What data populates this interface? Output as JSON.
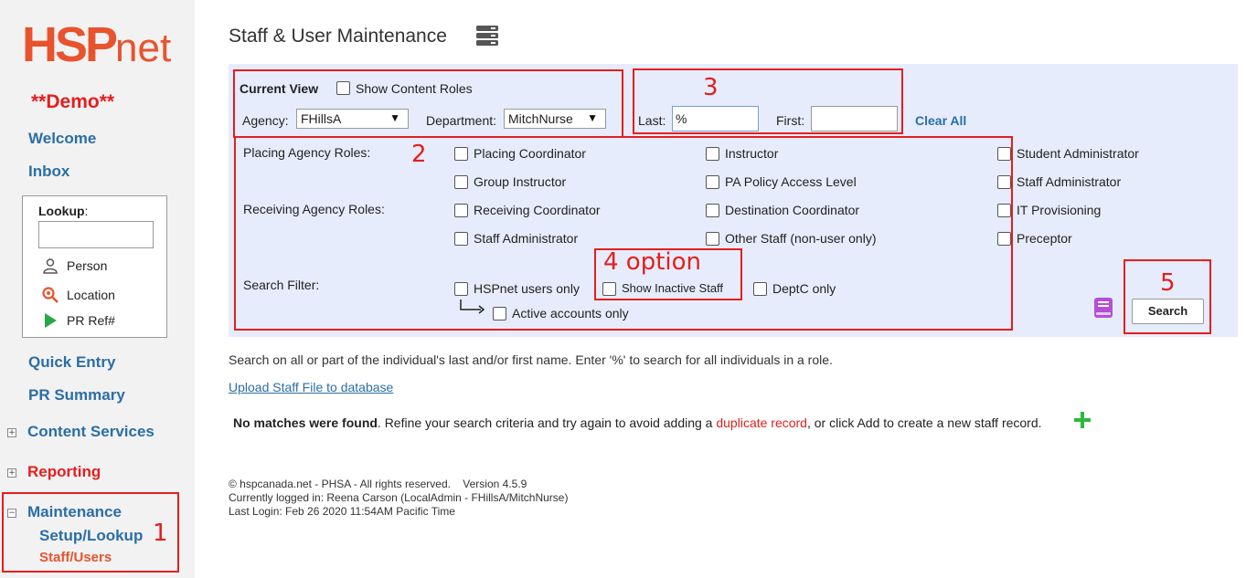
{
  "sidebar": {
    "logo": {
      "hsp": "HSP",
      "net": "net"
    },
    "demo": "**Demo**",
    "welcome": "Welcome",
    "inbox": "Inbox",
    "lookup": {
      "label": "Lookup",
      "colon": ":",
      "input_value": "",
      "person": "Person",
      "location": "Location",
      "pr_ref": "PR Ref#"
    },
    "quick_entry": "Quick Entry",
    "pr_summary": "PR Summary",
    "content_services": "Content Services",
    "reporting": "Reporting",
    "maintenance": "Maintenance",
    "setup_lookup": "Setup/Lookup",
    "staff_users": "Staff/Users",
    "expand_plus": "+",
    "expand_minus": "−"
  },
  "main": {
    "title": "Staff & User Maintenance",
    "current_view": "Current View",
    "show_content_roles": "Show Content Roles",
    "agency_label": "Agency:",
    "agency_value": "FHillsA",
    "department_label": "Department:",
    "department_value": "MitchNurse",
    "last_label": "Last:",
    "last_value": "%",
    "first_label": "First:",
    "first_value": "",
    "clear_all": "Clear All",
    "placing_roles_label": "Placing Agency Roles:",
    "receiving_roles_label": "Receiving Agency Roles:",
    "search_filter_label": "Search Filter:",
    "roles": {
      "placing_coordinator": "Placing Coordinator",
      "group_instructor": "Group Instructor",
      "receiving_coordinator": "Receiving Coordinator",
      "staff_administrator": "Staff Administrator",
      "instructor": "Instructor",
      "pa_policy_access_level": "PA Policy Access Level",
      "destination_coordinator": "Destination Coordinator",
      "other_staff": "Other Staff (non-user only)",
      "student_administrator": "Student Administrator",
      "staff_administrator_2": "Staff Administrator",
      "it_provisioning": "IT Provisioning",
      "preceptor": "Preceptor"
    },
    "filters": {
      "hspnet_users_only": "HSPnet users only",
      "show_inactive_staff": "Show Inactive Staff",
      "deptc_only": "DeptC only",
      "active_accounts_only": "Active accounts only"
    },
    "search_button": "Search",
    "info_text": "Search on all or part of the individual's last and/or first name. Enter '%' to search for all individuals in a role.",
    "upload_link": "Upload Staff File to database",
    "no_matches_bold": "No matches were found",
    "no_matches_text": ". Refine your search criteria and try again to avoid adding a ",
    "duplicate_record": "duplicate record",
    "no_matches_tail": ", or click Add to create a new staff record.",
    "footer": {
      "line1": "© hspcanada.net - PHSA - All rights reserved.    Version 4.5.9",
      "line2": "Currently logged in: Reena Carson (LocalAdmin - FHillsA/MitchNurse)",
      "line3": "Last Login: Feb 26 2020 11:54AM Pacific Time"
    }
  },
  "annotations": {
    "n1": "1",
    "n2": "2",
    "n3": "3",
    "n4": "4 option",
    "n5": "5"
  },
  "colors": {
    "brand_orange": "#e8532e",
    "link_blue": "#2b6ea6",
    "annotation_red": "#e41e1e",
    "panel_bg": "#e6ecfb",
    "add_green": "#2db83d"
  },
  "icons": [
    "person-icon",
    "location-pin-icon",
    "play-arrow-icon",
    "server-icon",
    "book-icon",
    "add-plus-icon",
    "arrow-down-right-icon"
  ]
}
